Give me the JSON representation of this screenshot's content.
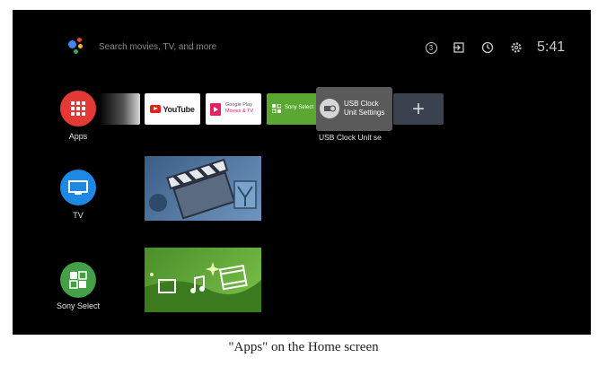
{
  "search": {
    "placeholder": "Search movies, TV, and more"
  },
  "status": {
    "notifications": "3",
    "time": "5:41"
  },
  "sidebar": {
    "apps": {
      "label": "Apps",
      "color": "#e53935"
    },
    "tv": {
      "label": "TV",
      "color": "#1e88e5"
    },
    "sony": {
      "label": "Sony Select",
      "color": "#43a047"
    }
  },
  "apps_row": {
    "youtube": "YouTube",
    "googleplay_line1": "Google Play",
    "googleplay_line2": "Movies & TV",
    "sony_select": "Sony Select",
    "usb_title_line1": "USB Clock",
    "usb_title_line2": "Unit Settings",
    "usb_caption": "USB Clock Unit se",
    "add": "+"
  },
  "caption": "\"Apps\" on the Home screen"
}
